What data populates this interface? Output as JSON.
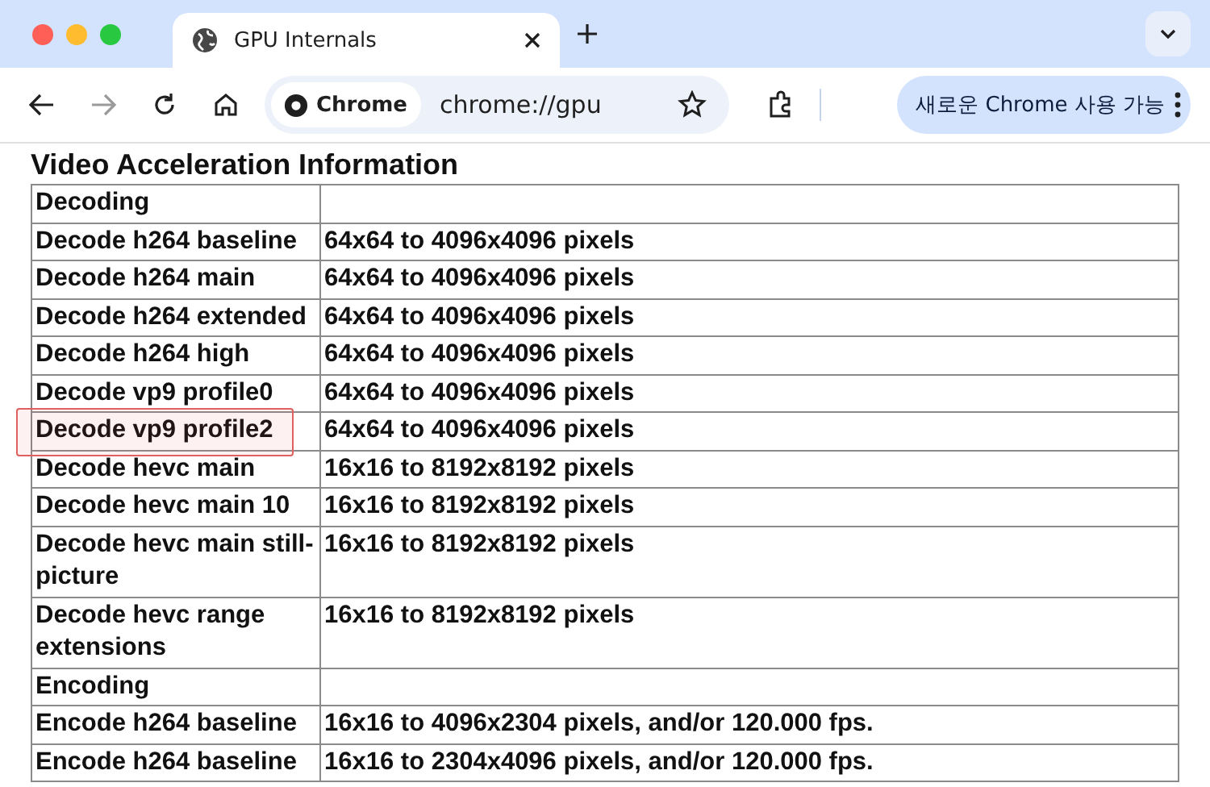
{
  "tabs": [
    {
      "title": "GPU Internals",
      "selected": true
    }
  ],
  "toolbar": {
    "chip": "Chrome",
    "url": "chrome://gpu",
    "update_button": "새로운 Chrome 사용 가능"
  },
  "heading": "Video Acceleration Information",
  "rows": [
    {
      "kind": "section",
      "label": "Decoding",
      "value": ""
    },
    {
      "kind": "entry",
      "label": "Decode h264 baseline",
      "value": "64x64 to 4096x4096 pixels",
      "highlighted": false
    },
    {
      "kind": "entry",
      "label": "Decode h264 main",
      "value": "64x64 to 4096x4096 pixels",
      "highlighted": false
    },
    {
      "kind": "entry",
      "label": "Decode h264 extended",
      "value": "64x64 to 4096x4096 pixels",
      "highlighted": false
    },
    {
      "kind": "entry",
      "label": "Decode h264 high",
      "value": "64x64 to 4096x4096 pixels",
      "highlighted": false
    },
    {
      "kind": "entry",
      "label": "Decode vp9 profile0",
      "value": "64x64 to 4096x4096 pixels",
      "highlighted": false
    },
    {
      "kind": "entry",
      "label": "Decode vp9 profile2",
      "value": "64x64 to 4096x4096 pixels",
      "highlighted": true
    },
    {
      "kind": "entry",
      "label": "Decode hevc main",
      "value": "16x16 to 8192x8192 pixels",
      "highlighted": false
    },
    {
      "kind": "entry",
      "label": "Decode hevc main 10",
      "value": "16x16 to 8192x8192 pixels",
      "highlighted": false
    },
    {
      "kind": "entry",
      "label": "Decode hevc main still-picture",
      "value": "16x16 to 8192x8192 pixels",
      "highlighted": false
    },
    {
      "kind": "entry",
      "label": "Decode hevc range extensions",
      "value": "16x16 to 8192x8192 pixels",
      "highlighted": false
    },
    {
      "kind": "section",
      "label": "Encoding",
      "value": ""
    },
    {
      "kind": "entry",
      "label": "Encode h264 baseline",
      "value": "16x16 to 4096x2304 pixels, and/or 120.000 fps.",
      "highlighted": false
    },
    {
      "kind": "entry",
      "label": "Encode h264 baseline",
      "value": "16x16 to 2304x4096 pixels, and/or 120.000 fps.",
      "highlighted": false
    }
  ]
}
